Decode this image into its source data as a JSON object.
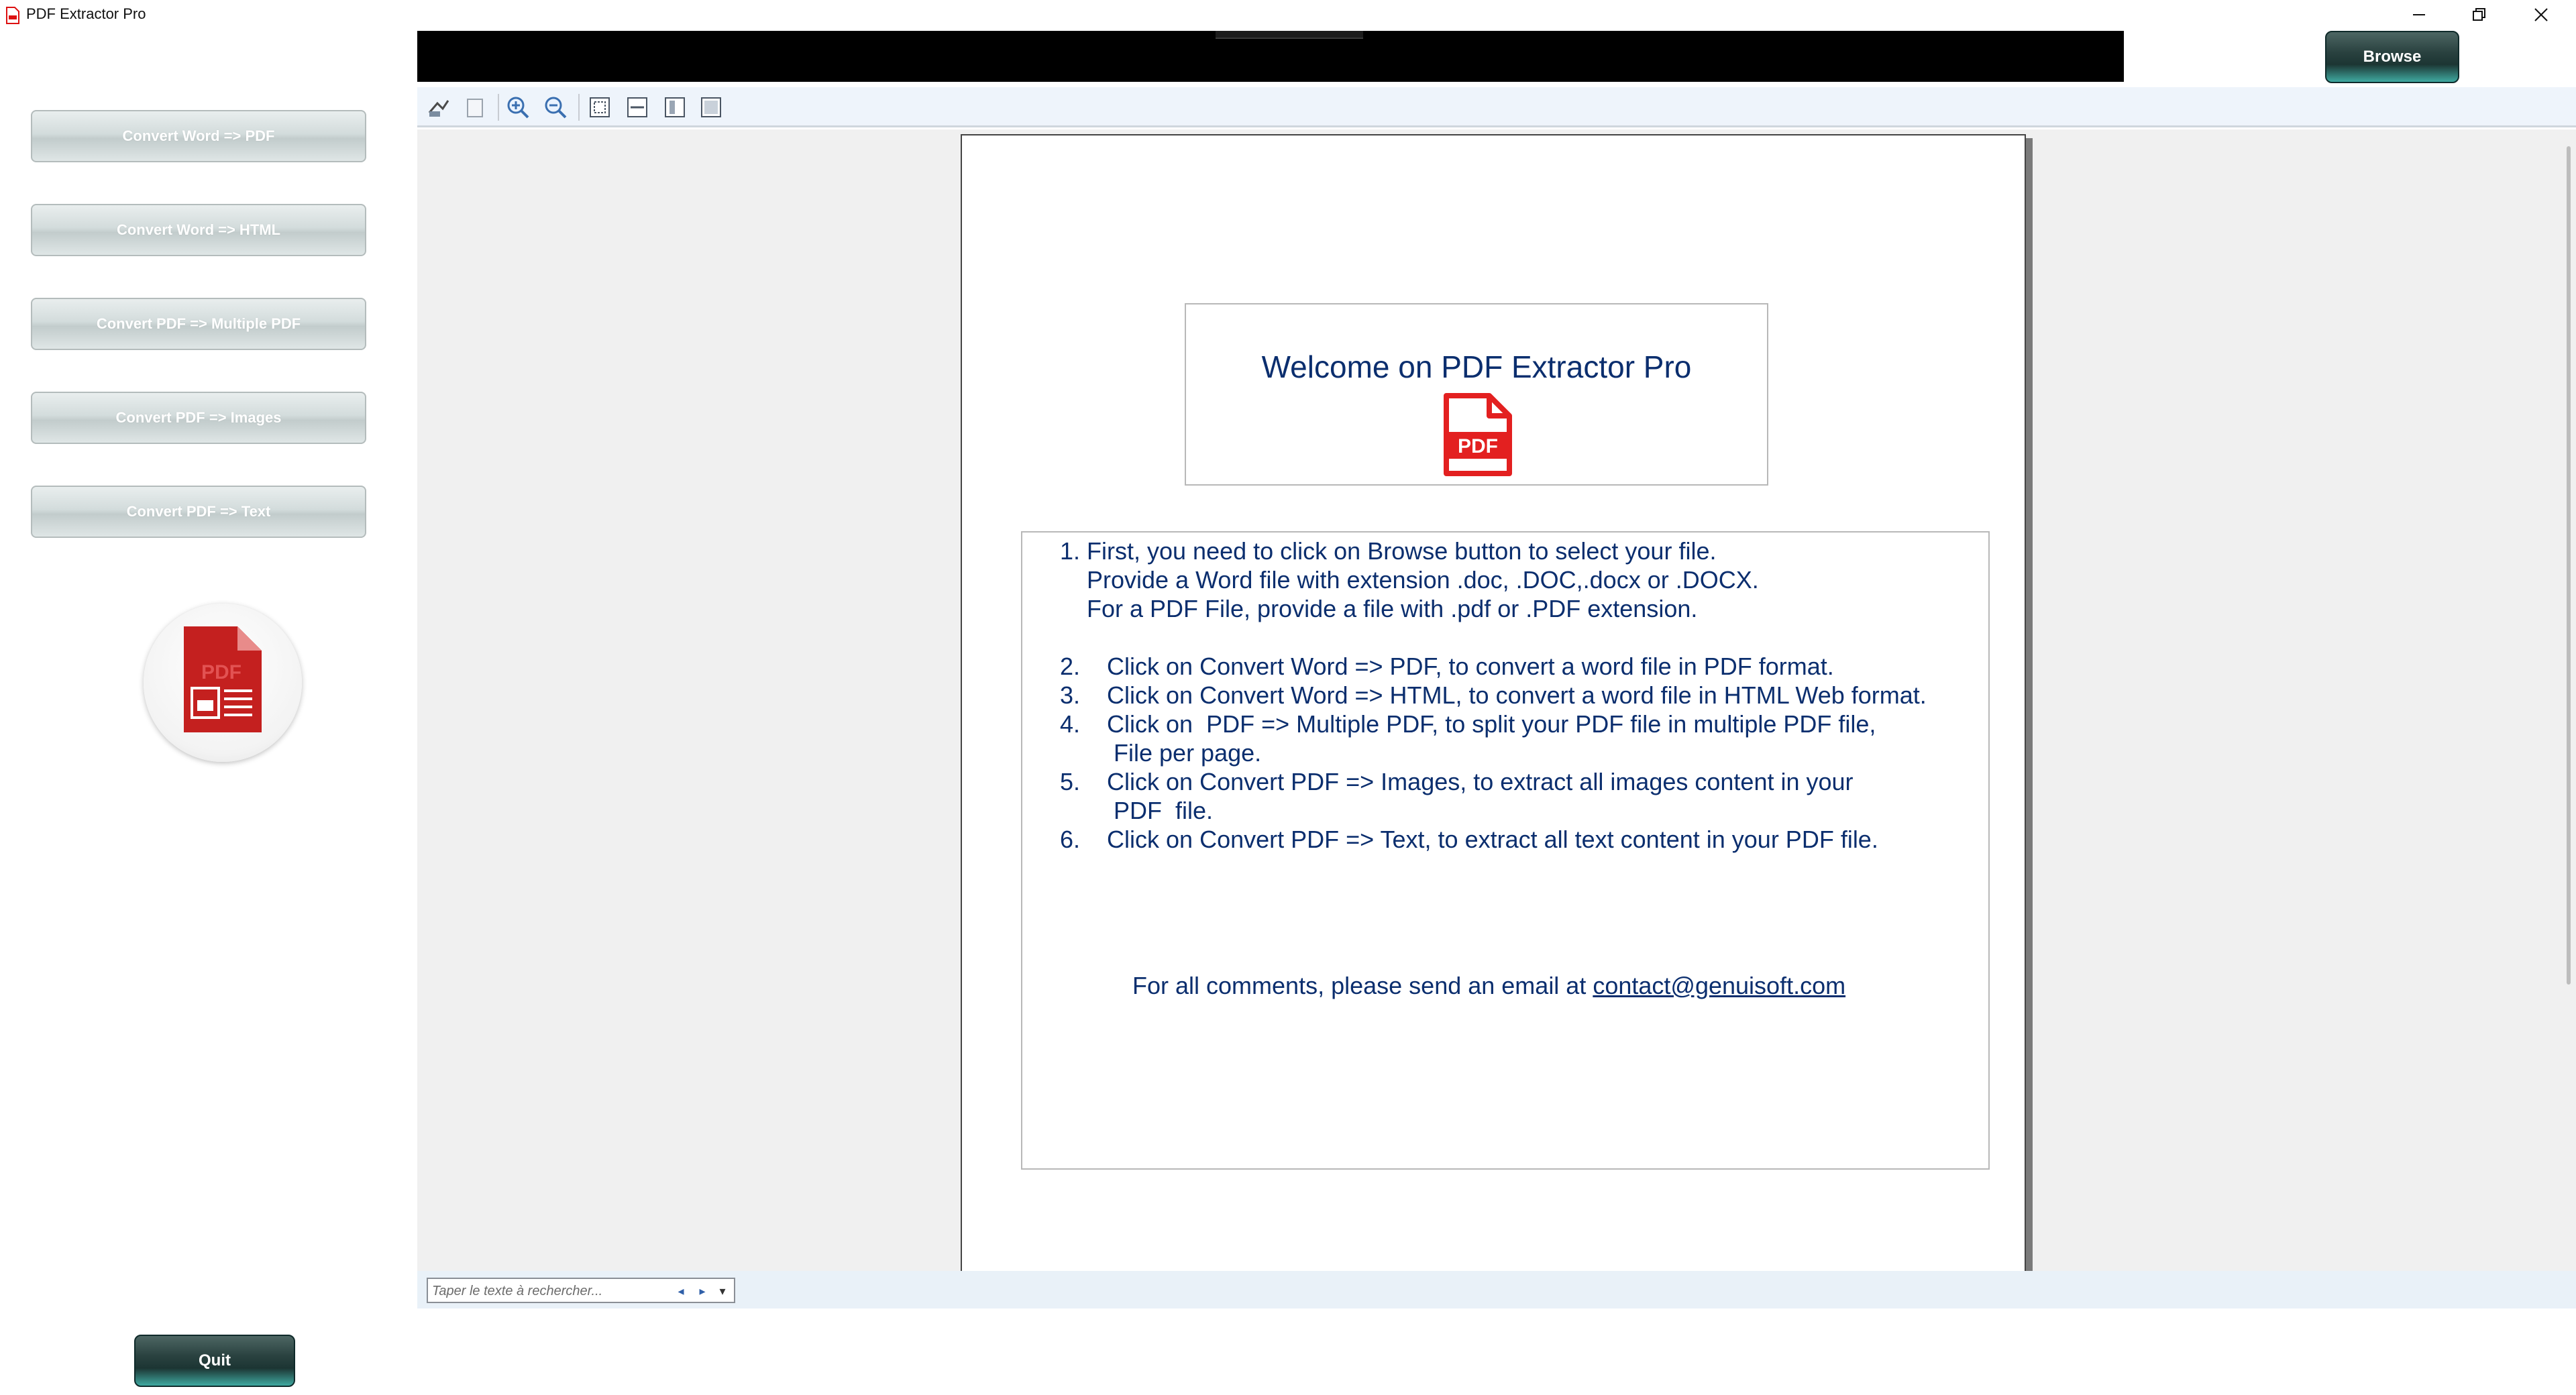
{
  "window": {
    "title": "PDF Extractor Pro",
    "minimize_icon": "minimize-icon",
    "maximize_icon": "restore-icon",
    "close_icon": "close-icon"
  },
  "sidebar": {
    "buttons": [
      {
        "label": "Convert Word => PDF"
      },
      {
        "label": "Convert Word => HTML"
      },
      {
        "label": "Convert PDF => Multiple PDF"
      },
      {
        "label": "Convert PDF => Images"
      },
      {
        "label": "Convert PDF => Text"
      }
    ],
    "logo_icon": "pdf-document-icon",
    "quit_label": "Quit"
  },
  "header": {
    "browse_label": "Browse"
  },
  "toolbar": {
    "icons": [
      "print-icon",
      "copy-icon",
      "zoom-in-icon",
      "zoom-out-icon",
      "fit-page-icon",
      "fit-width-icon",
      "single-page-icon",
      "full-page-icon"
    ]
  },
  "document": {
    "welcome_title": "Welcome on PDF Extractor Pro",
    "pdf_badge": "PDF",
    "lines": [
      "1. First, you need to click on Browse button to select your file.",
      "    Provide a Word file with extension .doc, .DOC,.docx or .DOCX.",
      "    For a PDF File, provide a file with .pdf or .PDF extension.",
      "2.    Click on Convert Word => PDF, to convert a word file in PDF format.",
      "3.    Click on Convert Word => HTML, to convert a word file in HTML Web format.",
      "4.    Click on  PDF => Multiple PDF, to split your PDF file in multiple PDF file,",
      "        File per page.",
      "5.    Click on Convert PDF => Images, to extract all images content in your",
      "        PDF  file.",
      "6.    Click on Convert PDF => Text, to extract all text content in your PDF file."
    ],
    "contact_prefix": "For all comments, please send an email at ",
    "contact_email": "contact@genuisoft.com"
  },
  "search": {
    "placeholder": "Taper le texte à rechercher...",
    "value": ""
  },
  "colors": {
    "accent_text": "#0b2e6e",
    "pdf_red": "#e32020",
    "dark_button": "#1c3533",
    "button_teal_glow": "#3fa9a0"
  }
}
